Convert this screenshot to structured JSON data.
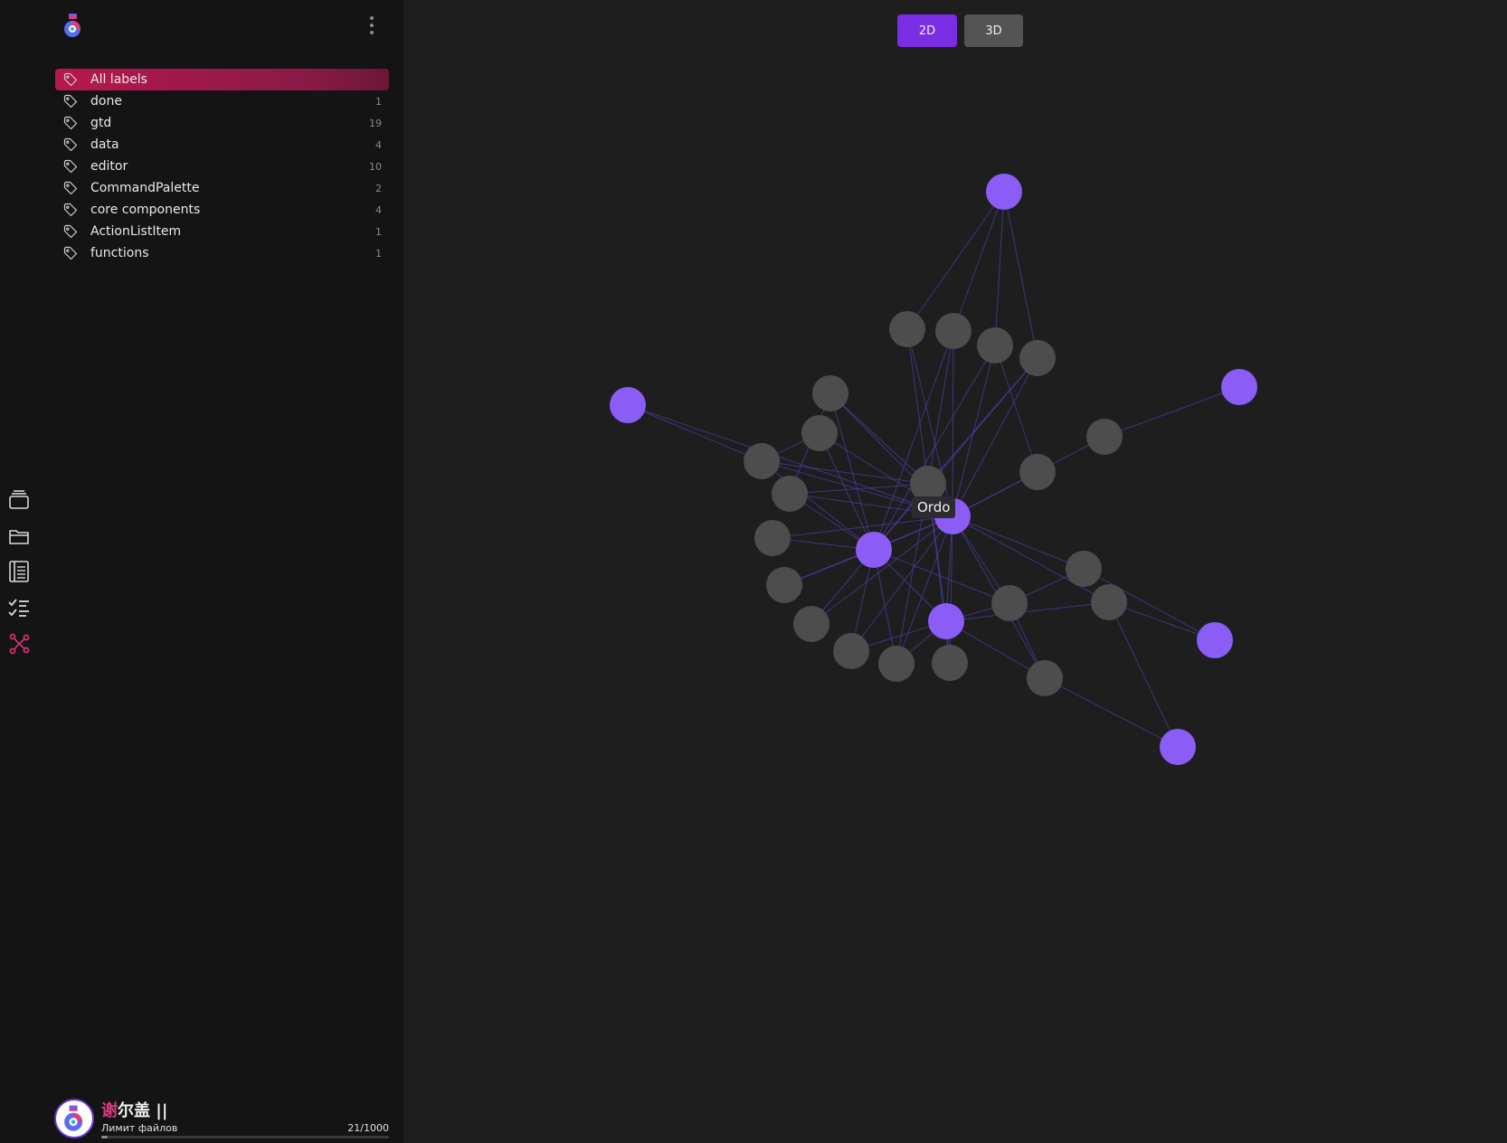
{
  "sidebar": {
    "labels": [
      {
        "name": "All labels",
        "count": ""
      },
      {
        "name": "done",
        "count": "1"
      },
      {
        "name": "gtd",
        "count": "19"
      },
      {
        "name": "data",
        "count": "4"
      },
      {
        "name": "editor",
        "count": "10"
      },
      {
        "name": "CommandPalette",
        "count": "2"
      },
      {
        "name": "core components",
        "count": "4"
      },
      {
        "name": "ActionListItem",
        "count": "1"
      },
      {
        "name": "functions",
        "count": "1"
      }
    ],
    "active_index": 0
  },
  "rail": {
    "items": [
      {
        "icon": "stack-icon",
        "active": false
      },
      {
        "icon": "folder-icon",
        "active": false
      },
      {
        "icon": "notes-list-icon",
        "active": false
      },
      {
        "icon": "checklist-icon",
        "active": false
      },
      {
        "icon": "graph-icon",
        "active": true
      }
    ]
  },
  "user": {
    "name_accent": "谢",
    "name_rest": "尔盖 ||",
    "limit_label": "Лимит файлов",
    "limit_value": "21/1000",
    "limit_fraction": 0.021
  },
  "graph": {
    "mode_2d_label": "2D",
    "mode_3d_label": "3D",
    "active_mode": "2D",
    "tooltip": "Ordo",
    "colors": {
      "label_node": "#8b5cf6",
      "note_node": "#4d4d4d",
      "edge": "#4b3fa6",
      "accent": "#b7174f"
    }
  }
}
